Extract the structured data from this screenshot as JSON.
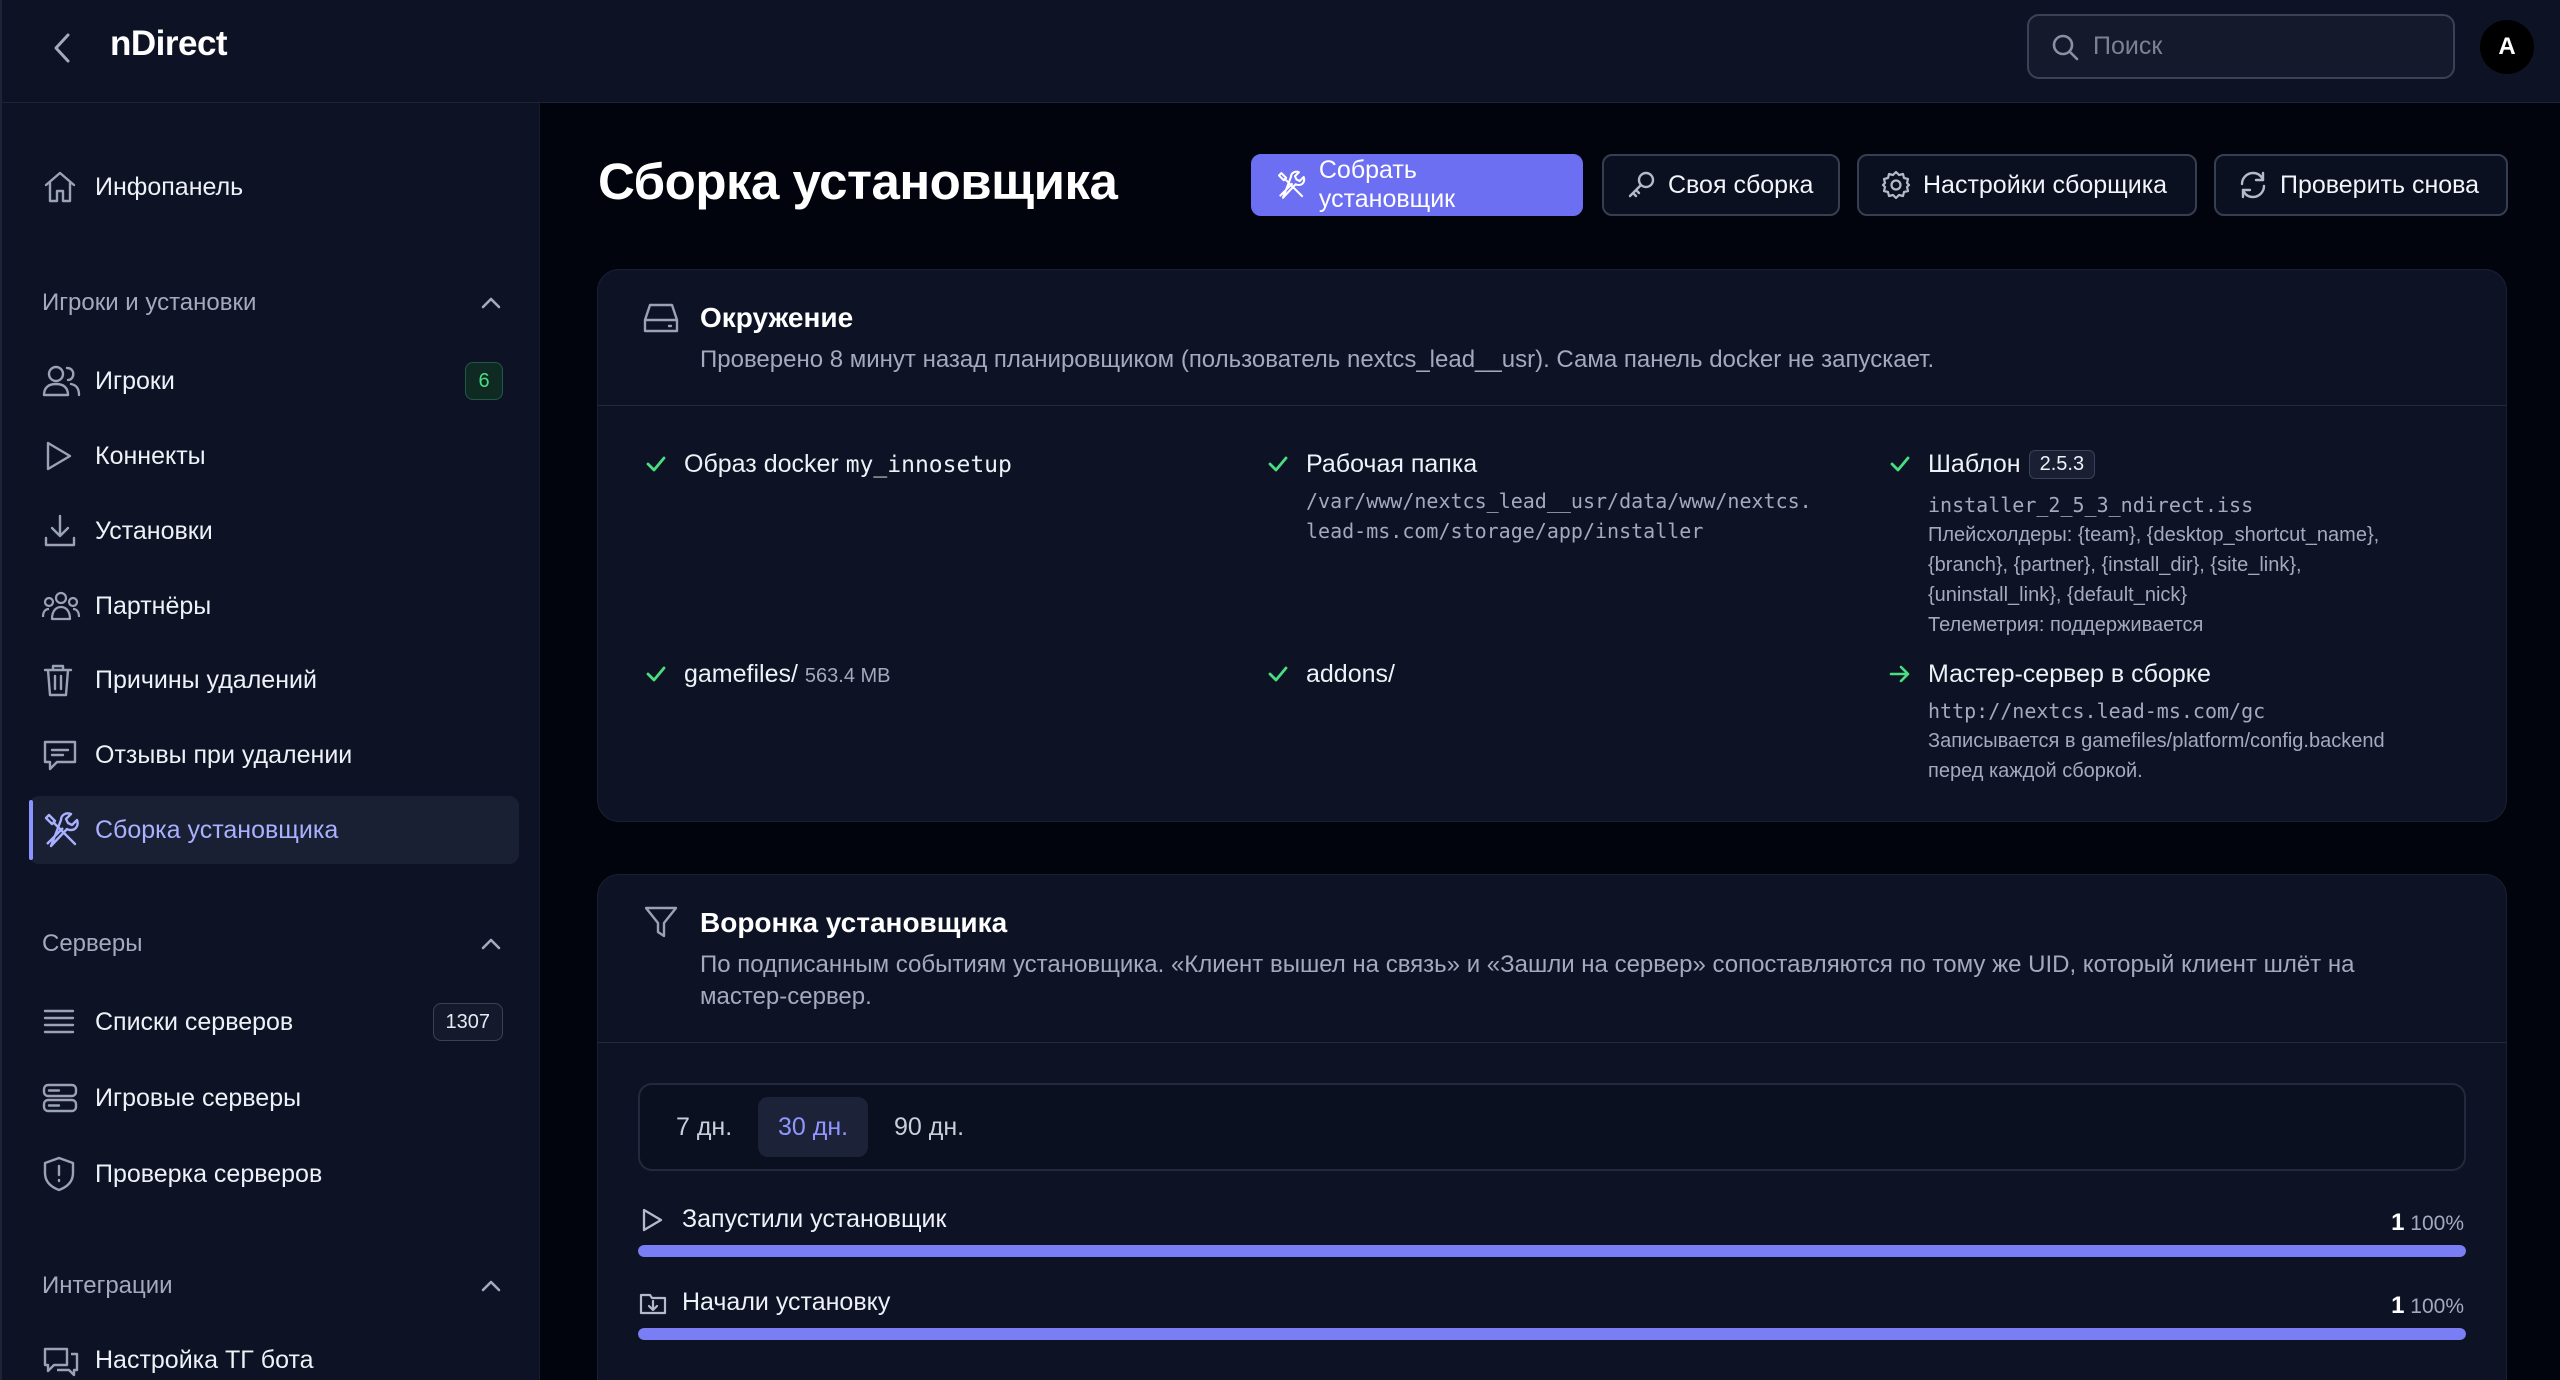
{
  "app": {
    "title": "nDirect"
  },
  "search": {
    "placeholder": "Поиск"
  },
  "user": {
    "avatar_letter": "A"
  },
  "sidebar": {
    "dashboard": "Инфопанель",
    "sections": [
      {
        "title": "Игроки и установки"
      },
      {
        "title": "Серверы"
      },
      {
        "title": "Интеграции"
      }
    ],
    "players": {
      "label": "Игроки",
      "badge": "6"
    },
    "connects": "Коннекты",
    "installs": "Установки",
    "partners": "Партнёры",
    "uninstall_reasons": "Причины удалений",
    "uninstall_feedback": "Отзывы при удалении",
    "installer_build": "Сборка установщика",
    "server_lists": {
      "label": "Списки серверов",
      "badge": "1307"
    },
    "game_servers": "Игровые серверы",
    "server_check": "Проверка серверов",
    "tg_bot": "Настройка ТГ бота"
  },
  "page": {
    "title": "Сборка установщика",
    "buttons": {
      "build": "Собрать установщик",
      "custom": "Своя сборка",
      "settings": "Настройки сборщика",
      "recheck": "Проверить снова"
    }
  },
  "environment": {
    "title": "Окружение",
    "subtitle": "Проверено 8 минут назад планировщиком (пользователь nextcs_lead__usr). Сама панель docker не запускает.",
    "docker": {
      "label": "Образ docker",
      "image": "my_innosetup"
    },
    "workdir": {
      "label": "Рабочая папка",
      "path_line1": "/var/www/nextcs_lead__usr/data/www/nextcs.",
      "path_line2": "lead-ms.com/storage/app/installer"
    },
    "template": {
      "label": "Шаблон",
      "version": "2.5.3",
      "file": "installer_2_5_3_ndirect.iss",
      "placeholders_line1": "Плейсхолдеры: {team}, {desktop_shortcut_name},",
      "placeholders_line2": "{branch}, {partner}, {install_dir}, {site_link},",
      "placeholders_line3": "{uninstall_link}, {default_nick}",
      "telemetry": "Телеметрия: поддерживается"
    },
    "gamefiles": {
      "label": "gamefiles/",
      "size": "563.4 MB"
    },
    "addons": {
      "label": "addons/"
    },
    "master": {
      "label": "Мастер-сервер в сборке",
      "url": "http://nextcs.lead-ms.com/gc",
      "note_line1": "Записывается в gamefiles/platform/config.backend",
      "note_line2": "перед каждой сборкой."
    }
  },
  "funnel": {
    "title": "Воронка установщика",
    "subtitle_line1": "По подписанным событиям установщика. «Клиент вышел на связь» и «Зашли на сервер» сопоставляются по тому же UID, который клиент шлёт на",
    "subtitle_line2": "мастер-сервер.",
    "tabs": [
      "7 дн.",
      "30 дн.",
      "90 дн."
    ],
    "active_tab": "30 дн.",
    "rows": [
      {
        "label": "Запустили установщик",
        "count": "1",
        "percent": "100%",
        "fraction": 1.0
      },
      {
        "label": "Начали установку",
        "count": "1",
        "percent": "100%",
        "fraction": 1.0
      }
    ]
  },
  "colors": {
    "accent": "#6d6ff2",
    "success": "#4ade80",
    "bar": "#7a7ef5"
  }
}
